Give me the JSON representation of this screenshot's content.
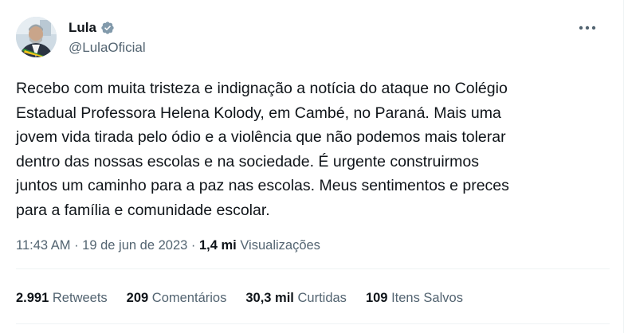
{
  "author": {
    "name": "Lula",
    "handle": "@LulaOficial",
    "verified_color": "#829aab"
  },
  "tweet": {
    "lines": [
      "Recebo com muita tristeza e indignação a notícia do ataque no Colégio",
      "Estadual Professora Helena Kolody, em Cambé, no Paraná. Mais uma",
      "jovem vida tirada pelo ódio e a violência que não podemos mais tolerar",
      "dentro das nossas escolas e na sociedade. É urgente construirmos",
      "juntos um caminho para a paz nas escolas. Meus sentimentos e preces",
      "para a família e comunidade escolar."
    ]
  },
  "meta": {
    "time": "11:43 AM",
    "separator": " · ",
    "date": "19 de jun de 2023",
    "views_count": "1,4 mi",
    "views_label": "Visualizações"
  },
  "stats": [
    {
      "count": "2.991",
      "label": "Retweets"
    },
    {
      "count": "209",
      "label": "Comentários"
    },
    {
      "count": "30,3 mil",
      "label": "Curtidas"
    },
    {
      "count": "109",
      "label": "Itens Salvos"
    }
  ],
  "icons": {
    "more": "more-horizontal-icon",
    "verified": "verified-badge-icon"
  }
}
